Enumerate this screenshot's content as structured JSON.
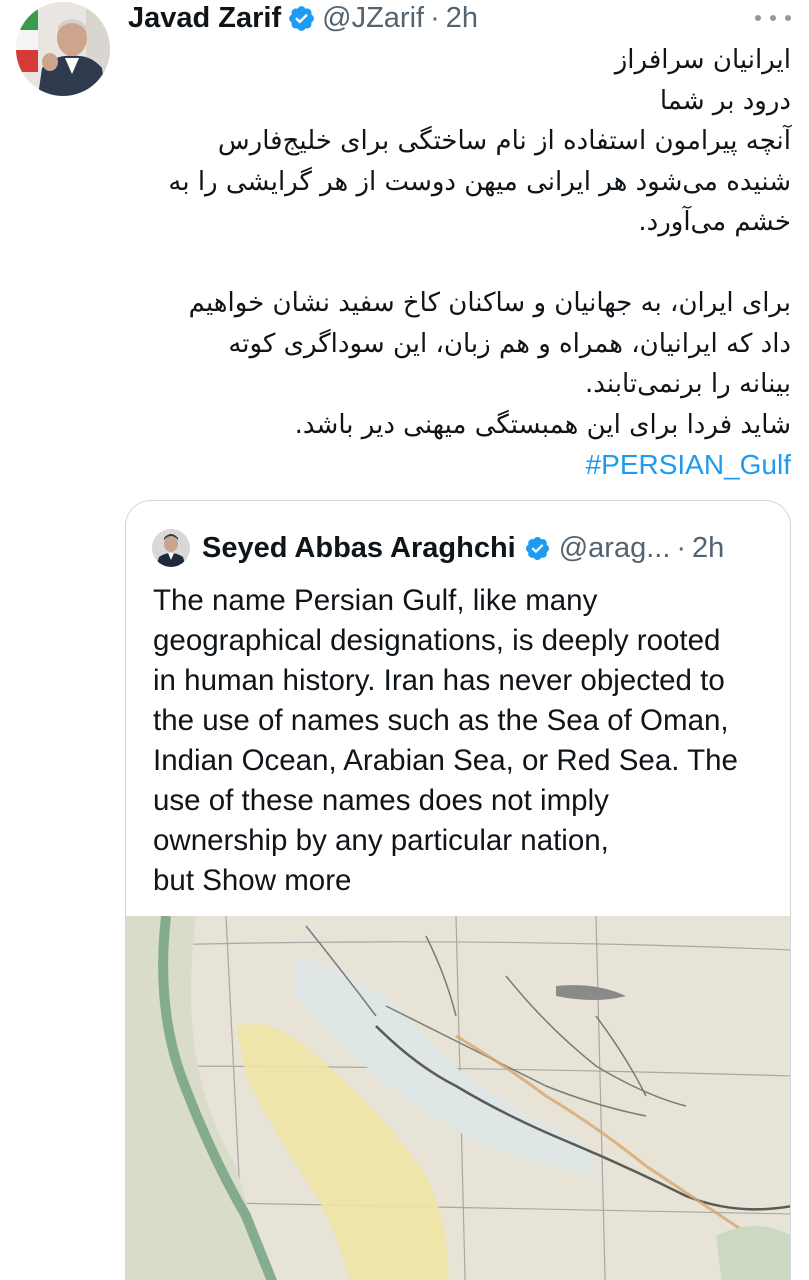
{
  "tweet": {
    "author_name": "Javad Zarif",
    "handle": "@JZarif",
    "separator": "·",
    "time": "2h",
    "body_lines": [
      "ایرانیان سرافراز",
      "درود بر شما",
      "آنچه پیرامون استفاده از نام ساختگی برای خلیج‌فارس",
      "شنیده می‌شود هر ایرانی میهن دوست از هر گرایشی را به",
      "خشم می‌آورد.",
      "",
      "برای ایران، به جهانیان و ساکنان کاخ سفید نشان خواهیم",
      "داد که ایرانیان، همراه و هم زبان، این سوداگری کوته",
      "بینانه را برنمی‌تابند.",
      "شاید فردا برای این همبستگی میهنی دیر باشد."
    ],
    "hashtag": "#PERSIAN_Gulf"
  },
  "quote": {
    "author_name": "Seyed Abbas Araghchi",
    "handle": "@arag...",
    "separator": "·",
    "time": "2h",
    "text_lines": [
      "The name Persian Gulf, like many",
      "geographical designations, is deeply rooted",
      "in human history. Iran has never objected to",
      "the use of names such as the Sea of Oman,",
      "Indian Ocean, Arabian Sea, or Red Sea. The",
      "use of these names does not imply",
      "ownership by any particular nation,"
    ],
    "last_line_prefix": "but ",
    "show_more": "Show more"
  },
  "icons": {
    "verified": "verified-badge-icon",
    "more": "more-options-icon"
  },
  "colors": {
    "link": "#1d9bf0",
    "muted": "#536471",
    "border": "#cfd9de",
    "map_paper": "#e7e3d6",
    "map_desert": "#f0e3a4",
    "map_coast": "#7fa98a"
  }
}
